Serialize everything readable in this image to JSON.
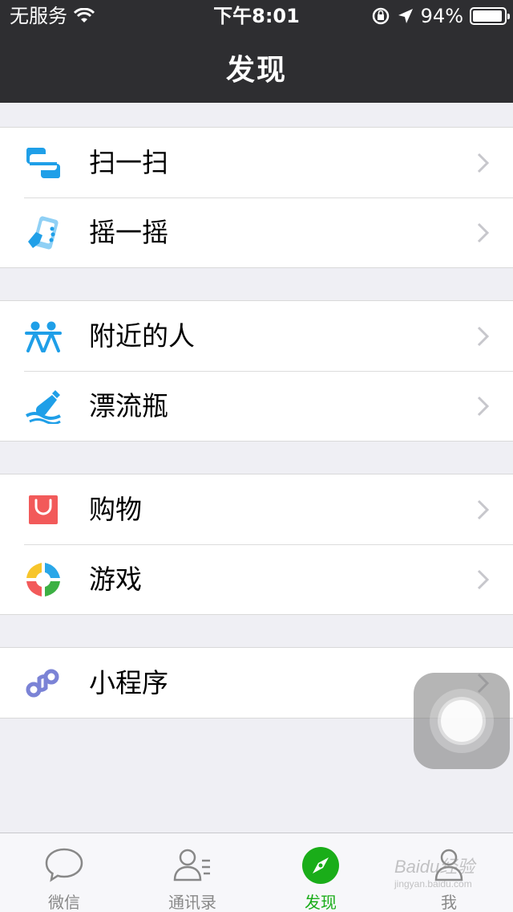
{
  "status_bar": {
    "carrier": "无服务",
    "time": "下午8:01",
    "battery": "94%",
    "battery_level": 0.94
  },
  "nav": {
    "title": "发现"
  },
  "groups": [
    {
      "items": [
        {
          "label": "扫一扫",
          "icon": "scan-icon"
        },
        {
          "label": "摇一摇",
          "icon": "shake-phone-icon"
        }
      ]
    },
    {
      "items": [
        {
          "label": "附近的人",
          "icon": "people-nearby-icon"
        },
        {
          "label": "漂流瓶",
          "icon": "drift-bottle-icon"
        }
      ]
    },
    {
      "items": [
        {
          "label": "购物",
          "icon": "shopping-bag-icon"
        },
        {
          "label": "游戏",
          "icon": "games-icon"
        }
      ]
    },
    {
      "items": [
        {
          "label": "小程序",
          "icon": "mini-program-icon"
        }
      ]
    }
  ],
  "tabs": [
    {
      "label": "微信",
      "icon": "chat-bubble-icon",
      "active": false
    },
    {
      "label": "通讯录",
      "icon": "contacts-icon",
      "active": false
    },
    {
      "label": "发现",
      "icon": "compass-icon",
      "active": true
    },
    {
      "label": "我",
      "icon": "profile-icon",
      "active": false
    }
  ],
  "colors": {
    "nav_bg": "#2e2e31",
    "accent_green": "#1aad19",
    "icon_blue": "#1f9fe8",
    "shopping_red": "#f25a5a",
    "mini_program_purple": "#7b83d6"
  },
  "watermark": {
    "text": "Baidu经验",
    "sub": "jingyan.baidu.com"
  }
}
